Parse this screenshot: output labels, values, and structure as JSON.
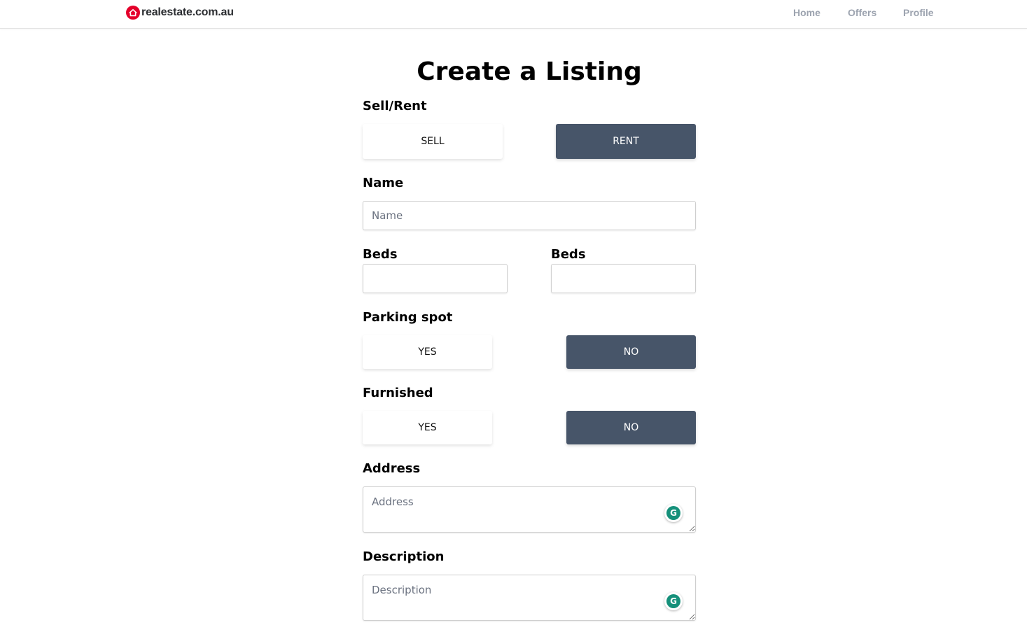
{
  "header": {
    "logo_text": "realestate.com.au",
    "nav": {
      "home": "Home",
      "offers": "Offers",
      "profile": "Profile"
    }
  },
  "form": {
    "title": "Create a Listing",
    "type": {
      "label": "Sell/Rent",
      "option_sell": "SELL",
      "option_rent": "RENT",
      "selected": "RENT"
    },
    "name": {
      "label": "Name",
      "placeholder": "Name",
      "value": ""
    },
    "beds": {
      "label": "Beds",
      "value": ""
    },
    "beds_second": {
      "label": "Beds",
      "value": ""
    },
    "parking": {
      "label": "Parking spot",
      "option_yes": "YES",
      "option_no": "NO",
      "selected": "NO"
    },
    "furnished": {
      "label": "Furnished",
      "option_yes": "YES",
      "option_no": "NO",
      "selected": "NO"
    },
    "address": {
      "label": "Address",
      "placeholder": "Address",
      "value": ""
    },
    "description": {
      "label": "Description",
      "placeholder": "Description",
      "value": ""
    }
  },
  "colors": {
    "brand": "#e4002b",
    "selected_button": "#475569",
    "grammarly": "#15907a"
  },
  "icons": {
    "logo": "house-icon",
    "assistant": "grammarly-icon"
  }
}
